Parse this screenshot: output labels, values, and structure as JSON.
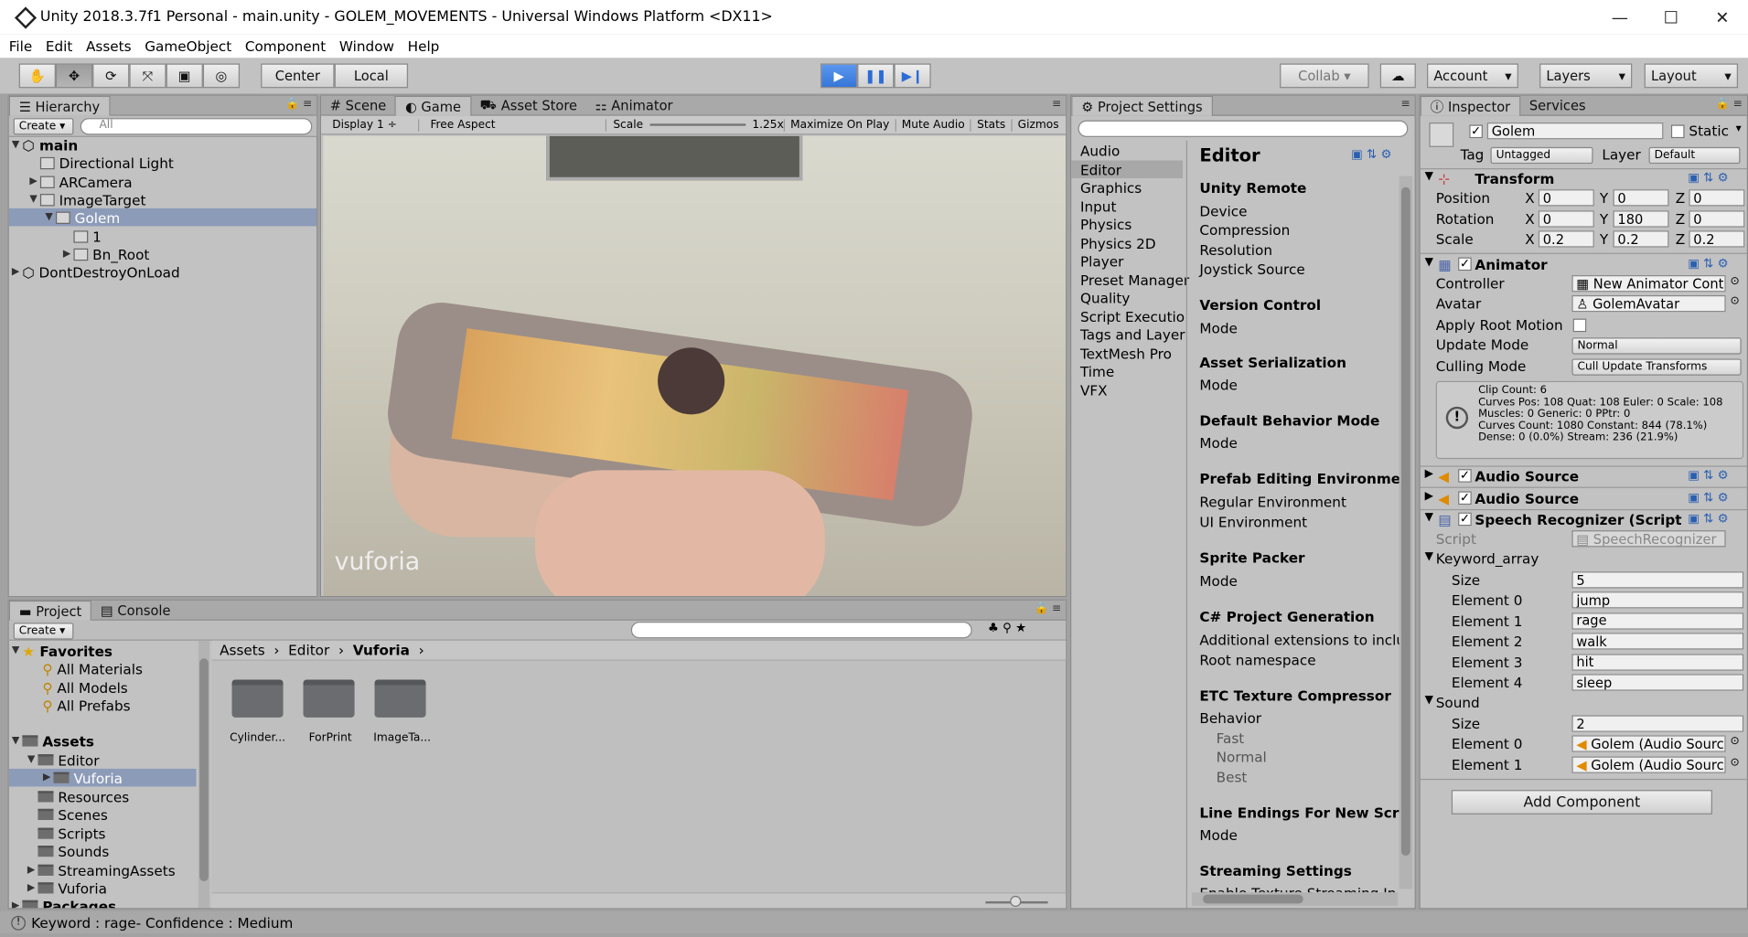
{
  "window": {
    "title": "Unity 2018.3.7f1 Personal - main.unity - GOLEM_MOVEMENTS - Universal Windows Platform <DX11>",
    "min": "—",
    "max": "☐",
    "close": "✕"
  },
  "menu": [
    "File",
    "Edit",
    "Assets",
    "GameObject",
    "Component",
    "Window",
    "Help"
  ],
  "toolbar": {
    "center": "Center",
    "local": "Local",
    "collab": "Collab",
    "account": "Account",
    "layers": "Layers",
    "layout": "Layout"
  },
  "hierarchy": {
    "tab": "Hierarchy",
    "create": "Create",
    "search_placeholder": "All",
    "items": [
      "main",
      "Directional Light",
      "ARCamera",
      "ImageTarget",
      "Golem",
      "1",
      "Bn_Root",
      "DontDestroyOnLoad"
    ]
  },
  "gameview": {
    "tabs": [
      "Scene",
      "Game",
      "Asset Store",
      "Animator"
    ],
    "display": "Display 1",
    "aspect": "Free Aspect",
    "scale_label": "Scale",
    "scale_value": "1.25x",
    "buttons": [
      "Maximize On Play",
      "Mute Audio",
      "Stats",
      "Gizmos"
    ],
    "watermark": "vuforia"
  },
  "project_settings": {
    "tab": "Project Settings",
    "categories": [
      "Audio",
      "Editor",
      "Graphics",
      "Input",
      "Physics",
      "Physics 2D",
      "Player",
      "Preset Manager",
      "Quality",
      "Script Executio",
      "Tags and Layer",
      "TextMesh Pro",
      "Time",
      "VFX"
    ],
    "heading": "Editor",
    "sections": [
      {
        "title": "Unity Remote",
        "items": [
          "Device",
          "Compression",
          "Resolution",
          "Joystick Source"
        ]
      },
      {
        "title": "Version Control",
        "items": [
          "Mode"
        ]
      },
      {
        "title": "Asset Serialization",
        "items": [
          "Mode"
        ]
      },
      {
        "title": "Default Behavior Mode",
        "items": [
          "Mode"
        ]
      },
      {
        "title": "Prefab Editing Environments",
        "items": [
          "Regular Environment",
          "UI Environment"
        ]
      },
      {
        "title": "Sprite Packer",
        "items": [
          "Mode"
        ]
      },
      {
        "title": "C# Project Generation",
        "items": [
          "Additional extensions to includ",
          "Root namespace"
        ]
      },
      {
        "title": "ETC Texture Compressor",
        "items": [
          "Behavior",
          "Fast",
          "Normal",
          "Best"
        ]
      },
      {
        "title": "Line Endings For New Script",
        "items": [
          "Mode"
        ]
      },
      {
        "title": "Streaming Settings",
        "items": [
          "Enable Texture Streaming In P"
        ]
      }
    ]
  },
  "inspector": {
    "tabs": [
      "Inspector",
      "Services"
    ],
    "name": "Golem",
    "static": "Static",
    "tag_label": "Tag",
    "tag": "Untagged",
    "layer_label": "Layer",
    "layer": "Default",
    "transform": {
      "title": "Transform",
      "position_label": "Position",
      "rotation_label": "Rotation",
      "scale_label": "Scale",
      "axis_x": "X",
      "axis_y": "Y",
      "axis_z": "Z",
      "position": [
        "0",
        "0",
        "0"
      ],
      "rotation": [
        "0",
        "180",
        "0"
      ],
      "scale": [
        "0.2",
        "0.2",
        "0.2"
      ]
    },
    "animator": {
      "title": "Animator",
      "controller_label": "Controller",
      "controller": "New Animator Contr",
      "avatar_label": "Avatar",
      "avatar": "GolemAvatar",
      "root_motion_label": "Apply Root Motion",
      "update_label": "Update Mode",
      "update": "Normal",
      "culling_label": "Culling Mode",
      "culling": "Cull Update Transforms",
      "info": [
        "Clip Count: 6",
        "Curves Pos: 108 Quat: 108 Euler: 0 Scale: 108",
        "Muscles: 0 Generic: 0 PPtr: 0",
        "Curves Count: 1080 Constant: 844 (78.1%)",
        "Dense: 0 (0.0%) Stream: 236 (21.9%)"
      ]
    },
    "audio1": "Audio Source",
    "audio2": "Audio Source",
    "speech": {
      "title": "Speech Recognizer (Script",
      "script_label": "Script",
      "script": "SpeechRecognizer",
      "keyword_label": "Keyword_array",
      "size_label": "Size",
      "size": "5",
      "elements": [
        {
          "label": "Element 0",
          "value": "jump"
        },
        {
          "label": "Element 1",
          "value": "rage"
        },
        {
          "label": "Element 2",
          "value": "walk"
        },
        {
          "label": "Element 3",
          "value": "hit"
        },
        {
          "label": "Element 4",
          "value": "sleep"
        }
      ],
      "sound_label": "Sound",
      "sound_size": "2",
      "sounds": [
        {
          "label": "Element 0",
          "value": "Golem (Audio Sourc"
        },
        {
          "label": "Element 1",
          "value": "Golem (Audio Sourc"
        }
      ]
    },
    "add_component": "Add Component"
  },
  "project": {
    "tabs": [
      "Project",
      "Console"
    ],
    "create": "Create",
    "breadcrumb": [
      "Assets",
      "Editor",
      "Vuforia"
    ],
    "tree": [
      "Favorites",
      "All Materials",
      "All Models",
      "All Prefabs",
      "Assets",
      "Editor",
      "Vuforia",
      "Resources",
      "Scenes",
      "Scripts",
      "Sounds",
      "StreamingAssets",
      "Vuforia",
      "Packages"
    ],
    "files": [
      "Cylinder...",
      "ForPrint",
      "ImageTa..."
    ]
  },
  "status": "Keyword : rage- Confidence : Medium"
}
